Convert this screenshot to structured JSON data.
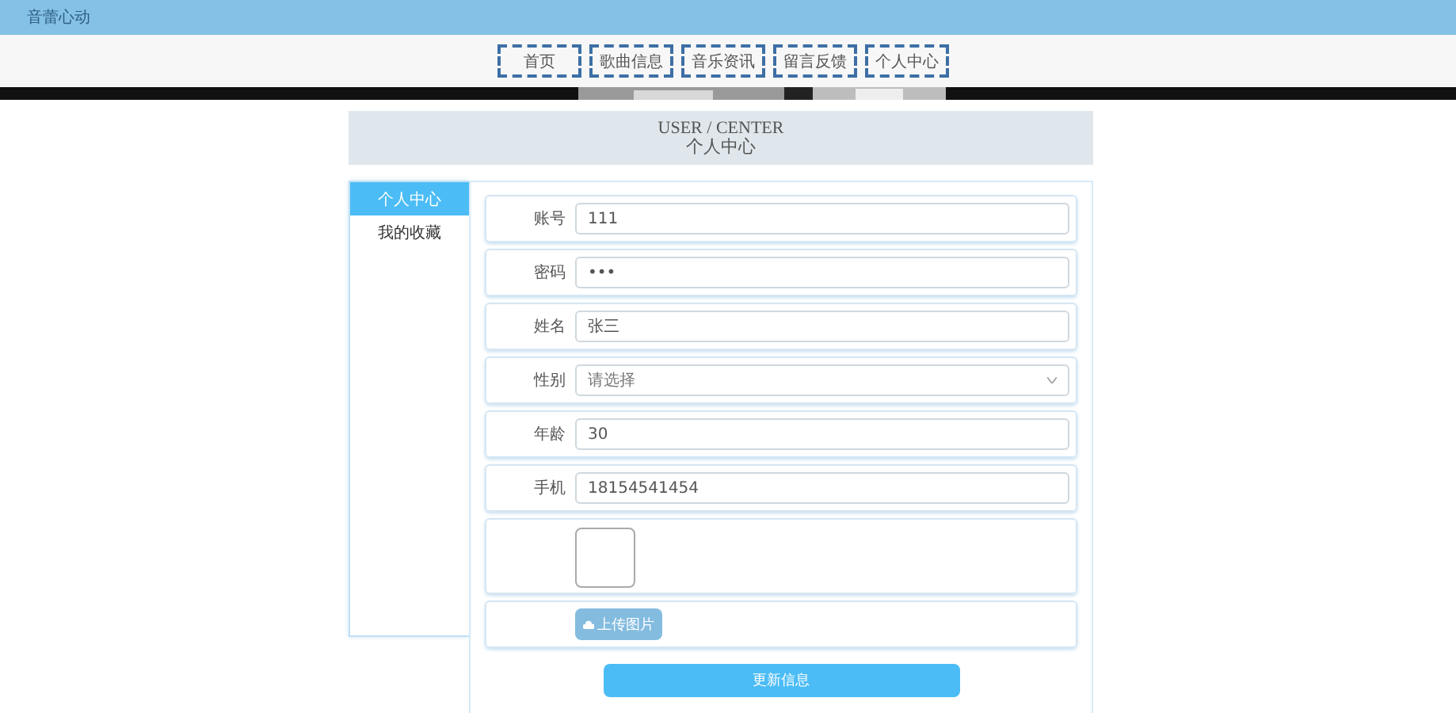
{
  "header": {
    "title": "音蕾心动"
  },
  "nav": [
    {
      "label": "首页"
    },
    {
      "label": "歌曲信息"
    },
    {
      "label": "音乐资讯"
    },
    {
      "label": "留言反馈"
    },
    {
      "label": "个人中心"
    }
  ],
  "page_heading": {
    "title": "USER / CENTER",
    "subtitle": "个人中心"
  },
  "sidebar": {
    "items": [
      {
        "label": "个人中心",
        "selected": true
      },
      {
        "label": "我的收藏",
        "selected": false
      }
    ]
  },
  "form": {
    "fields": [
      {
        "kind": "text",
        "label": "账号",
        "value": "111"
      },
      {
        "kind": "password",
        "label": "密码",
        "value": "•••"
      },
      {
        "kind": "text",
        "label": "姓名",
        "value": "张三"
      },
      {
        "kind": "select",
        "label": "性别",
        "placeholder": "请选择"
      },
      {
        "kind": "text",
        "label": "年龄",
        "value": "30"
      },
      {
        "kind": "text",
        "label": "手机",
        "value": "18154541454"
      }
    ],
    "upload_button": "上传图片",
    "submit_button": "更新信息"
  }
}
